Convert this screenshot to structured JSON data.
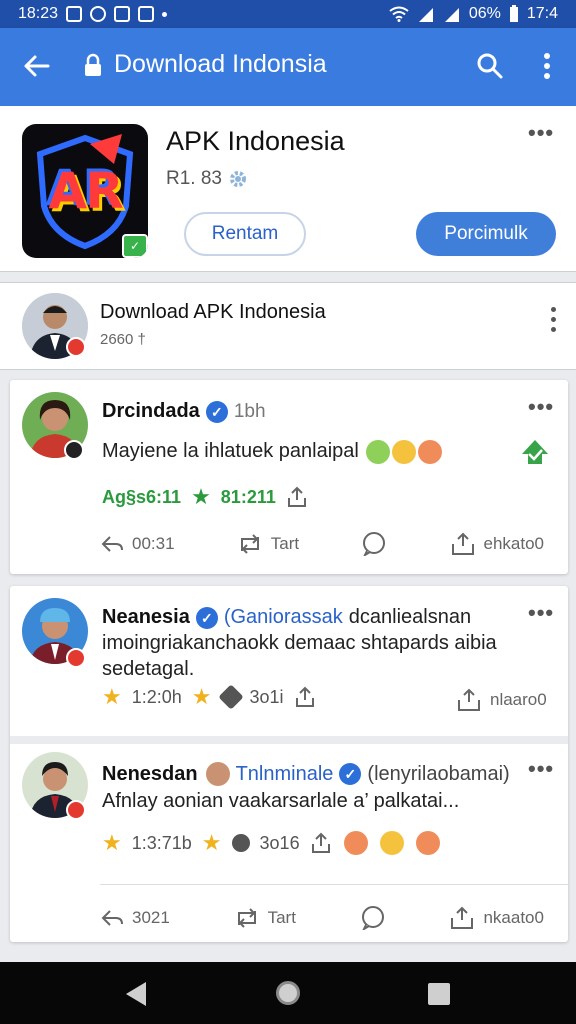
{
  "status_bar": {
    "time_left": "18:23",
    "battery": "06%",
    "time_right": "17:4"
  },
  "app_bar": {
    "title": "Download Indonsia"
  },
  "app_card": {
    "icon_text": "AR",
    "name": "APK Indonesia",
    "meta": "R1. 83",
    "secondary_button": "Rentam",
    "primary_button": "Porcimulk"
  },
  "page_card": {
    "name": "Download APK Indonesia",
    "sub": "2660 †"
  },
  "posts": [
    {
      "author": "Drcindada",
      "time": "1bh",
      "text": "Mayiene la ihlatuek panlaipal",
      "stat_a": "Ag§s6:11",
      "stat_b": "81:211",
      "actions": {
        "reply": "00:31",
        "repost": "Tart",
        "share": "ehkato0"
      }
    },
    {
      "author": "Neanesia",
      "handle": "(Ganiorassak",
      "text_line1": "dcanliealsnan",
      "text_line2": "imoingriakanchaokk demaac shtapards aibia",
      "text_line3": "sedetagal.",
      "stat_a": "1:2:0h",
      "stat_b": "3o1i",
      "share": "nlaaro0"
    },
    {
      "author": "Nenesdan",
      "handle": "Tnlnminale",
      "handle2": "(lenyrilaobamai)",
      "text": "Afnlay aonian vaakarsarlale a’ palkatai...",
      "stat_a": "1:3:71b",
      "stat_b": "3o16",
      "actions": {
        "reply": "3021",
        "repost": "Tart",
        "share": "nkaato0"
      }
    }
  ]
}
